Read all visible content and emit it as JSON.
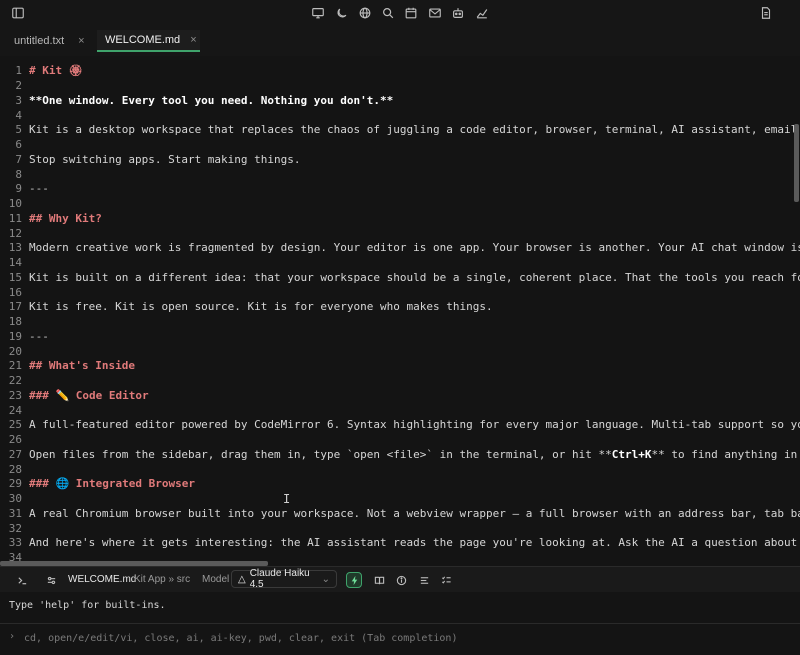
{
  "toolbar": {
    "icons": [
      "sidebar-toggle-icon",
      "monitor-icon",
      "moon-icon",
      "globe-icon",
      "search-icon",
      "calendar-icon",
      "mail-icon",
      "bot-icon",
      "chart-icon",
      "document-icon"
    ]
  },
  "tabs": [
    {
      "label": "untitled.txt",
      "close": "×"
    },
    {
      "label": "WELCOME.md",
      "close": "×"
    }
  ],
  "editor": {
    "lines": [
      {
        "n": "1",
        "text": "# Kit 🏵"
      },
      {
        "n": "2",
        "text": ""
      },
      {
        "n": "3",
        "text": "**One window. Every tool you need. Nothing you don't.**"
      },
      {
        "n": "4",
        "text": ""
      },
      {
        "n": "5",
        "text": "Kit is a desktop workspace that replaces the chaos of juggling a code editor, browser, terminal, AI assistant, email cli"
      },
      {
        "n": "6",
        "text": ""
      },
      {
        "n": "7",
        "text": "Stop switching apps. Start making things."
      },
      {
        "n": "8",
        "text": ""
      },
      {
        "n": "9",
        "text": "---"
      },
      {
        "n": "10",
        "text": ""
      },
      {
        "n": "11",
        "text": "## Why Kit?"
      },
      {
        "n": "12",
        "text": ""
      },
      {
        "n": "13",
        "text": "Modern creative work is fragmented by design. Your editor is one app. Your browser is another. Your AI chat window is a"
      },
      {
        "n": "14",
        "text": ""
      },
      {
        "n": "15",
        "text": "Kit is built on a different idea: that your workspace should be a single, coherent place. That the tools you reach for to"
      },
      {
        "n": "16",
        "text": ""
      },
      {
        "n": "17",
        "text": "Kit is free. Kit is open source. Kit is for everyone who makes things."
      },
      {
        "n": "18",
        "text": ""
      },
      {
        "n": "19",
        "text": "---"
      },
      {
        "n": "20",
        "text": ""
      },
      {
        "n": "21",
        "text": "## What's Inside"
      },
      {
        "n": "22",
        "text": ""
      },
      {
        "n": "23",
        "text": "### ✏️ Code Editor"
      },
      {
        "n": "24",
        "text": ""
      },
      {
        "n": "25",
        "text": "A full-featured editor powered by CodeMirror 6. Syntax highlighting for every major language. Multi-tab support so you ca"
      },
      {
        "n": "26",
        "text": ""
      },
      {
        "n": "27",
        "text_a": "Open files from the sidebar, drag them in, type `open <file>` in the terminal, or hit **",
        "text_b": "Ctrl+K",
        "text_c": "** to find anything in you"
      },
      {
        "n": "28",
        "text": ""
      },
      {
        "n": "29",
        "text": "### 🌐 Integrated Browser"
      },
      {
        "n": "30",
        "text": ""
      },
      {
        "n": "31",
        "text": "A real Chromium browser built into your workspace. Not a webview wrapper — a full browser with an address bar, tab bar, b"
      },
      {
        "n": "32",
        "text": ""
      },
      {
        "n": "33",
        "text": "And here's where it gets interesting: the AI assistant reads the page you're looking at. Ask the AI a question about what"
      },
      {
        "n": "34",
        "text": ""
      }
    ]
  },
  "statusbar": {
    "file": "WELCOME.md",
    "path": "Kit App » src",
    "model_label": "Model",
    "model_value": "Claude Haiku 4.5"
  },
  "terminal": {
    "output": "Type 'help' for built-ins.",
    "prompt": "›",
    "placeholder": "cd, open/e/edit/vi, close, ai, ai-key, pwd, clear, exit (Tab completion)"
  },
  "colors": {
    "accent": "#3fa36b",
    "heading": "#e07a7a",
    "background": "#141414"
  }
}
